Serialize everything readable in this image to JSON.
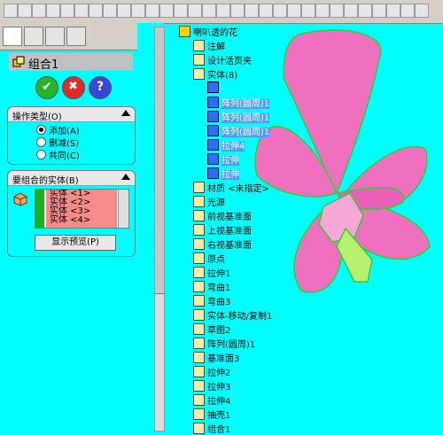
{
  "toolbar": {
    "buttons": 30
  },
  "property_manager": {
    "title": "组合1",
    "ok_label": "✔",
    "cancel_label": "✖",
    "help_label": "?",
    "operation_type": {
      "label": "操作类型(O)",
      "options": [
        {
          "label": "添加(A)",
          "selected": true
        },
        {
          "label": "删减(S)",
          "selected": false
        },
        {
          "label": "共同(C)",
          "selected": false
        }
      ]
    },
    "bodies": {
      "label": "要组合的实体(B)",
      "items": [
        "实体 <1>",
        "实体 <2>",
        "实体 <3>",
        "实体 <4>"
      ],
      "preview_button": "显示预览(P)"
    }
  },
  "tree": {
    "root": "喇叭透的花",
    "items": [
      {
        "label": "注解",
        "indent": 1
      },
      {
        "label": "设计活页夹",
        "indent": 1
      },
      {
        "label": "实体(8)",
        "indent": 1
      },
      {
        "label": "",
        "indent": 2,
        "solid": true
      },
      {
        "label": "阵列(圆周)1",
        "indent": 2,
        "solid": true,
        "selected": true
      },
      {
        "label": "阵列(圆周)1",
        "indent": 2,
        "solid": true,
        "selected": true
      },
      {
        "label": "阵列(圆周)1",
        "indent": 2,
        "solid": true,
        "selected": true
      },
      {
        "label": "拉伸4",
        "indent": 2,
        "solid": true,
        "selected": true
      },
      {
        "label": "拉伸",
        "indent": 2,
        "solid": true,
        "selected": true
      },
      {
        "label": "拉伸",
        "indent": 2,
        "solid": true,
        "selected": true
      },
      {
        "label": "材质 <未指定>",
        "indent": 1
      },
      {
        "label": "光源",
        "indent": 1
      },
      {
        "label": "前视基准面",
        "indent": 1
      },
      {
        "label": "上视基准面",
        "indent": 1
      },
      {
        "label": "右视基准面",
        "indent": 1
      },
      {
        "label": "原点",
        "indent": 1
      },
      {
        "label": "拉伸1",
        "indent": 1
      },
      {
        "label": "弯曲1",
        "indent": 1
      },
      {
        "label": "弯曲3",
        "indent": 1
      },
      {
        "label": "实体-移动/复制1",
        "indent": 1
      },
      {
        "label": "草图2",
        "indent": 1
      },
      {
        "label": "阵列(圆周)1",
        "indent": 1
      },
      {
        "label": "基准面3",
        "indent": 1
      },
      {
        "label": "拉伸2",
        "indent": 1
      },
      {
        "label": "拉伸3",
        "indent": 1
      },
      {
        "label": "拉伸4",
        "indent": 1
      },
      {
        "label": "抽壳1",
        "indent": 1
      },
      {
        "label": "组合1",
        "indent": 1
      }
    ]
  },
  "colors": {
    "background": "#00ffff",
    "petal": "#f070c0",
    "edge": "#2fd12f"
  }
}
